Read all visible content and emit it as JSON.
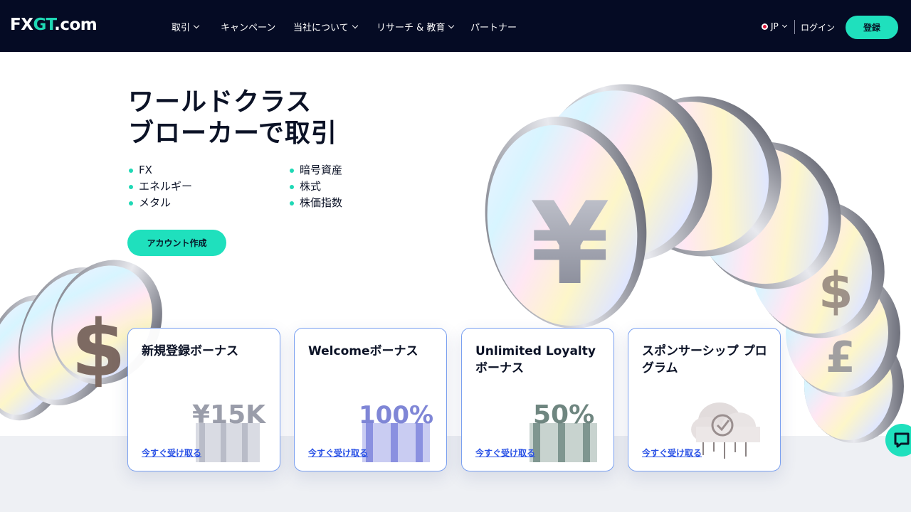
{
  "header": {
    "logo": {
      "part1": "FX",
      "part2": "GT",
      "part3": ".com"
    },
    "menu": [
      {
        "label": "取引",
        "has_dropdown": true
      },
      {
        "label": "キャンペーン",
        "has_dropdown": false
      },
      {
        "label": "当社について",
        "has_dropdown": true
      },
      {
        "label": "リサーチ & 教育",
        "has_dropdown": true
      },
      {
        "label": "パートナー",
        "has_dropdown": false
      }
    ],
    "language": "JP",
    "login_label": "ログイン",
    "register_label": "登録"
  },
  "hero": {
    "title_line1": "ワールドクラス",
    "title_line2": "ブローカーで取引",
    "assets_col1": [
      "FX",
      "エネルギー",
      "メタル"
    ],
    "assets_col2": [
      "暗号資産",
      "株式",
      "株価指数"
    ],
    "cta_label": "アカウント作成"
  },
  "cards": [
    {
      "title": "新規登録ボーナス",
      "art_text": "¥15K",
      "link": "今すぐ受け取る"
    },
    {
      "title": "Welcomeボーナス",
      "art_text": "100%",
      "link": "今すぐ受け取る"
    },
    {
      "title": "Unlimited Loyalty ボーナス",
      "art_text": "50%",
      "link": "今すぐ受け取る"
    },
    {
      "title": "スポンサーシップ プログラム",
      "art_text": "",
      "link": "今すぐ受け取る"
    }
  ],
  "colors": {
    "nav_bg": "#050b24",
    "accent": "#1fe0bd",
    "link": "#2a52e6",
    "card_border": "#7aa0f0"
  },
  "icons": {
    "chat": "chat-bubble-icon",
    "language_flag": "japan-flag-icon"
  }
}
